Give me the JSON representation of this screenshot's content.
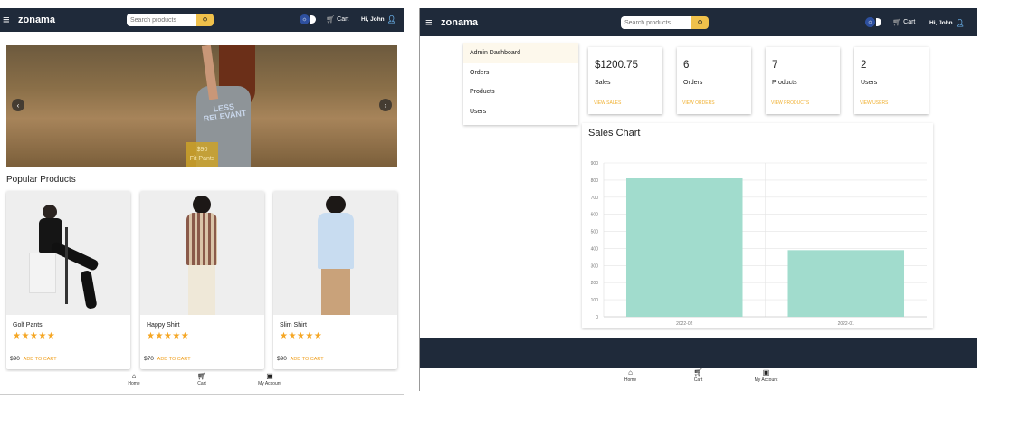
{
  "app": {
    "brand": "zonama",
    "search_placeholder": "Search products",
    "cart_label": "Cart",
    "user_greeting": "Hi, John"
  },
  "home": {
    "carousel": {
      "price": "$90",
      "caption": "Fit Pants",
      "shirt_text": "LESS RELEVANT"
    },
    "section_title": "Popular Products",
    "products": [
      {
        "name": "Golf Pants",
        "price": "$90",
        "rating": 5,
        "stars": "★★★★★",
        "cta": "ADD TO CART"
      },
      {
        "name": "Happy Shirt",
        "price": "$70",
        "rating": 5,
        "stars": "★★★★★",
        "cta": "ADD TO CART"
      },
      {
        "name": "Slim Shirt",
        "price": "$90",
        "rating": 5,
        "stars": "★★★★★",
        "cta": "ADD TO CART"
      }
    ]
  },
  "bottom_nav": [
    {
      "label": "Home",
      "icon": "home-icon"
    },
    {
      "label": "Cart",
      "icon": "cart-icon"
    },
    {
      "label": "My Account",
      "icon": "account-icon"
    }
  ],
  "admin": {
    "sidebar": [
      "Admin Dashboard",
      "Orders",
      "Products",
      "Users"
    ],
    "stats": [
      {
        "value": "$1200.75",
        "label": "Sales",
        "link": "VIEW SALES"
      },
      {
        "value": "6",
        "label": "Orders",
        "link": "VIEW ORDERS"
      },
      {
        "value": "7",
        "label": "Products",
        "link": "VIEW PRODUCTS"
      },
      {
        "value": "2",
        "label": "Users",
        "link": "VIEW USERS"
      }
    ],
    "chart_title": "Sales Chart"
  },
  "colors": {
    "appbar": "#1f2a3a",
    "accent": "#f0c14b",
    "bar": "#a1dccd",
    "star": "#f5a623"
  },
  "chart_data": {
    "type": "bar",
    "title": "Sales Chart",
    "categories": [
      "2022-02",
      "2022-01"
    ],
    "values": [
      810,
      390
    ],
    "ylim": [
      0,
      900
    ],
    "yticks": [
      0,
      100,
      200,
      300,
      400,
      500,
      600,
      700,
      800,
      900
    ],
    "grid": true,
    "xlabel": "",
    "ylabel": ""
  }
}
